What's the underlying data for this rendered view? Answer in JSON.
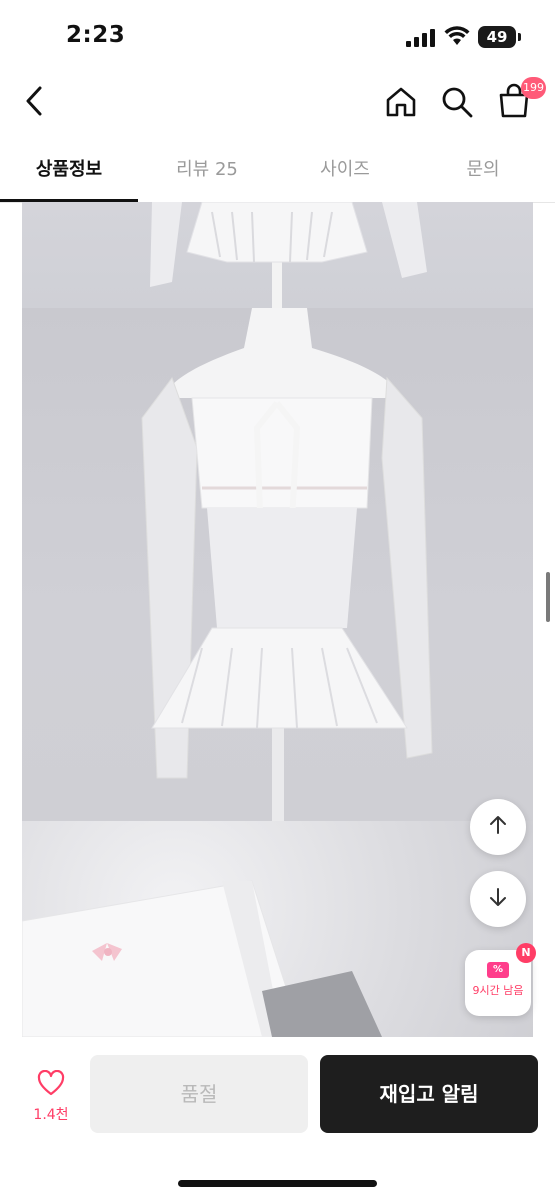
{
  "status_bar": {
    "time": "2:23",
    "battery": "49",
    "icons": [
      "signal-icon",
      "wifi-icon",
      "battery-icon"
    ]
  },
  "top_nav": {
    "icons": [
      "back-icon",
      "home-icon",
      "search-icon",
      "cart-icon"
    ],
    "cart_badge": "199"
  },
  "tabs": [
    {
      "label": "상품정보",
      "active": true
    },
    {
      "label": "리뷰 25",
      "active": false
    },
    {
      "label": "사이즈",
      "active": false
    },
    {
      "label": "문의",
      "active": false
    }
  ],
  "product_images": [
    {
      "name": "product-image-top"
    },
    {
      "name": "product-image-main"
    },
    {
      "name": "product-image-detail"
    }
  ],
  "floating": {
    "icons": [
      "arrow-up-icon",
      "arrow-down-icon",
      "coupon-icon"
    ],
    "coupon_label": "9시간 남음",
    "coupon_badge": "N"
  },
  "bottom_bar": {
    "like_count": "1.4천",
    "soldout_label": "품절",
    "restock_label": "재입고 알림"
  },
  "colors": {
    "accent": "#ff3d66",
    "primary_button": "#1e1e1e",
    "disabled_button": "#efefef"
  }
}
